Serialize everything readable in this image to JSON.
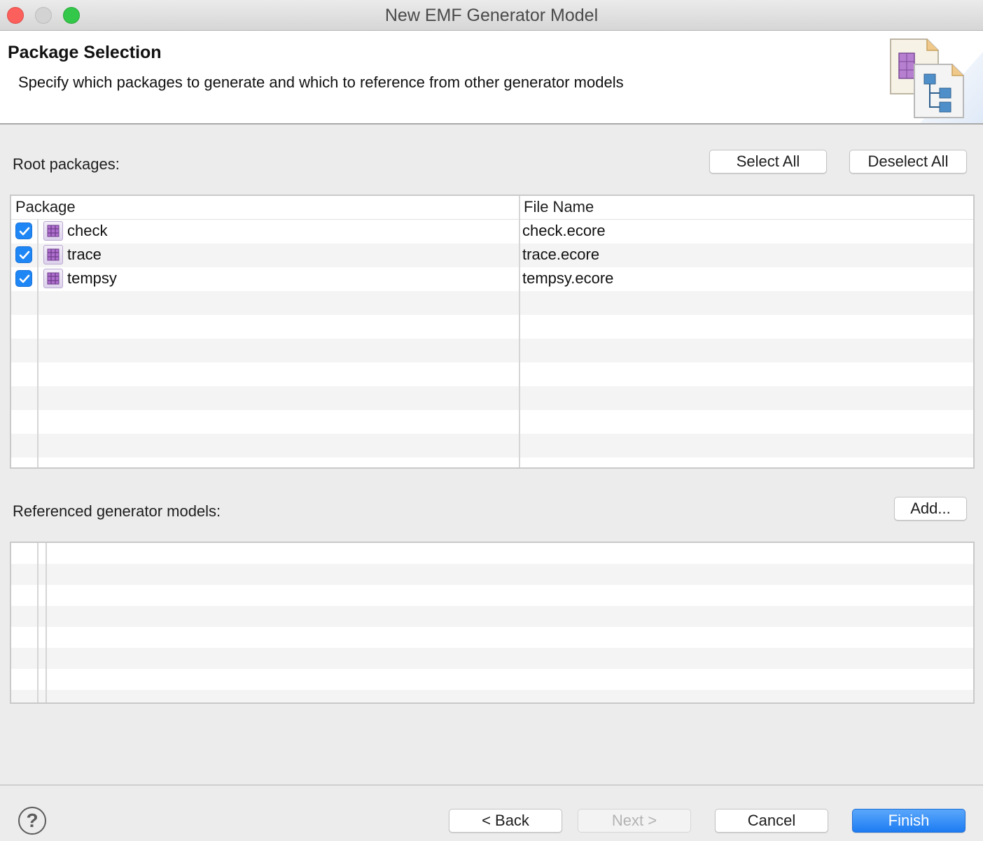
{
  "window": {
    "title": "New EMF Generator Model"
  },
  "banner": {
    "title": "Package Selection",
    "description": "Specify which packages to generate and which to reference from other generator models"
  },
  "root_packages": {
    "label": "Root packages:",
    "select_all": "Select All",
    "deselect_all": "Deselect All",
    "columns": [
      "Package",
      "File Name"
    ],
    "rows": [
      {
        "checked": true,
        "package": "check",
        "file": "check.ecore"
      },
      {
        "checked": true,
        "package": "trace",
        "file": "trace.ecore"
      },
      {
        "checked": true,
        "package": "tempsy",
        "file": "tempsy.ecore"
      }
    ]
  },
  "referenced": {
    "label": "Referenced generator models:",
    "add": "Add..."
  },
  "footer": {
    "help": "?",
    "back": "< Back",
    "next": "Next >",
    "cancel": "Cancel",
    "finish": "Finish"
  },
  "colors": {
    "accent": "#1e86f5",
    "primary_button": "#1d7cf2"
  }
}
